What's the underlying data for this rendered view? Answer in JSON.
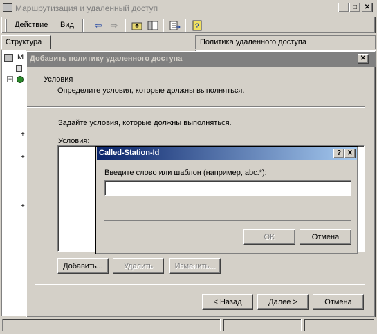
{
  "main_window": {
    "title": "Маршрутизация и удаленный доступ",
    "controls": {
      "minimize": "_",
      "maximize": "□",
      "close": "✕"
    },
    "menu": [
      "Действие",
      "Вид"
    ],
    "toolbar_icons": [
      "back-arrow-icon",
      "forward-arrow-icon",
      "up-folder-icon",
      "show-hide-tree-icon",
      "export-list-icon",
      "help-icon"
    ],
    "tree_header": "Структура",
    "right_header": "Политика удаленного доступа",
    "tree_glyphs": [
      "М",
      "+",
      "+",
      "+"
    ]
  },
  "wizard": {
    "title": "Добавить политику удаленного доступа",
    "close": "✕",
    "header_title": "Условия",
    "header_subtitle": "Определите условия, которые должны выполняться.",
    "instruction": "Задайте условия, которые должны выполняться.",
    "conditions_label": "Условия:",
    "conditions_items": [],
    "buttons": {
      "add": "Добавить...",
      "remove": "Удалить",
      "edit": "Изменить...",
      "back": "< Назад",
      "next": "Далее >",
      "cancel": "Отмена"
    }
  },
  "dialog": {
    "title": "Called-Station-Id",
    "help": "?",
    "close": "✕",
    "prompt": "Введите слово или шаблон (например, abc.*):",
    "input_value": "",
    "ok": "OK",
    "cancel": "Отмена"
  },
  "colors": {
    "face": "#d4d0c8",
    "active_title_start": "#0a246a",
    "active_title_end": "#a6caf0",
    "inactive_title": "#808080"
  }
}
